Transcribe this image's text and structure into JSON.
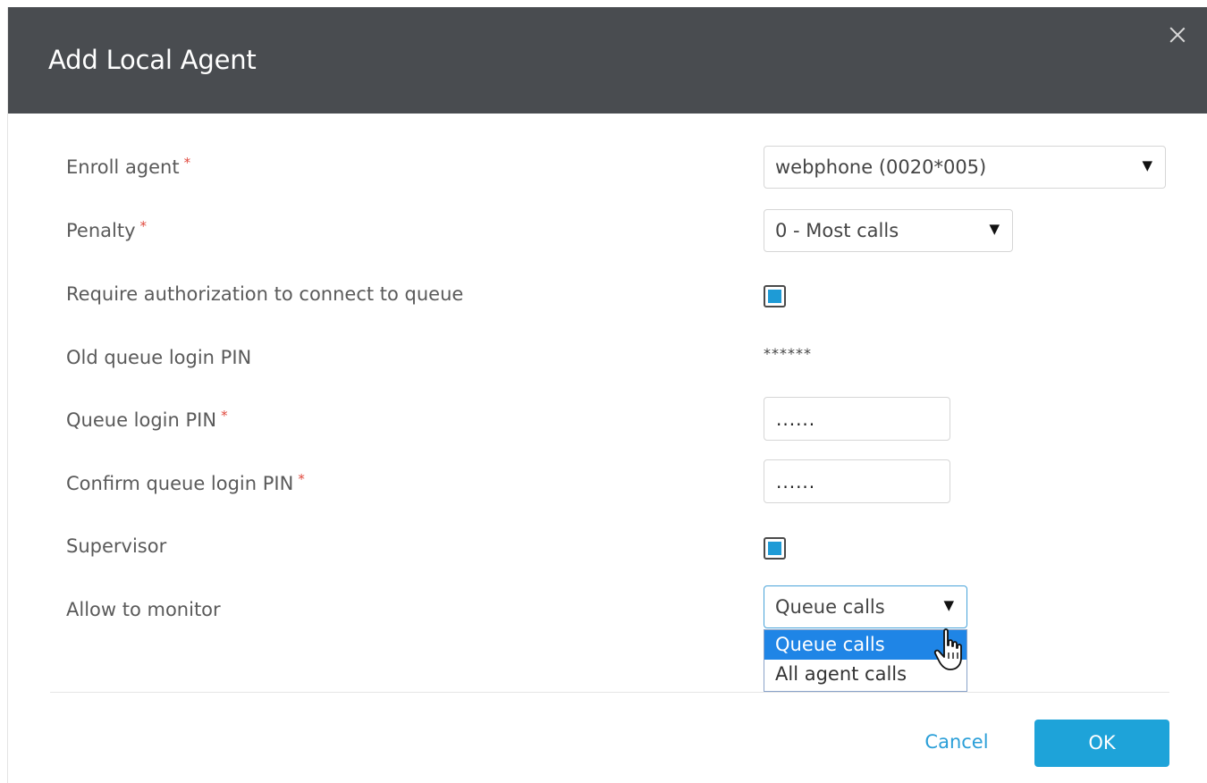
{
  "dialog": {
    "title": "Add Local Agent",
    "close_icon": "close-icon"
  },
  "form": {
    "enroll_agent": {
      "label": "Enroll agent",
      "required_mark": "*",
      "value": "webphone (0020*005)",
      "arrow": "▼"
    },
    "penalty": {
      "label": "Penalty",
      "required_mark": "*",
      "value": "0 - Most calls",
      "arrow": "▼"
    },
    "require_authorization": {
      "label": "Require authorization to connect to queue",
      "checked": true
    },
    "old_pin": {
      "label": "Old queue login PIN",
      "value": "******"
    },
    "queue_pin": {
      "label": "Queue login PIN",
      "required_mark": "*",
      "value": "......"
    },
    "confirm_pin": {
      "label": "Confirm queue login PIN",
      "required_mark": "*",
      "value": "......"
    },
    "supervisor": {
      "label": "Supervisor",
      "checked": true
    },
    "allow_to_monitor": {
      "label": "Allow to monitor",
      "value": "Queue calls",
      "arrow": "▼",
      "options": [
        "Queue calls",
        "All agent calls"
      ],
      "highlighted_option": "Queue calls"
    }
  },
  "footer": {
    "cancel_label": "Cancel",
    "ok_label": "OK"
  },
  "colors": {
    "header_bg": "#494c50",
    "accent": "#1ea3d9",
    "required": "#e0493e",
    "option_highlight": "#1f85e6"
  }
}
